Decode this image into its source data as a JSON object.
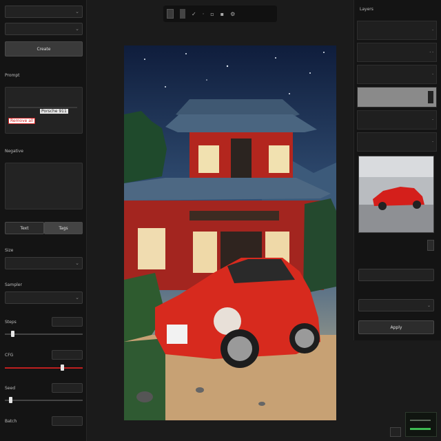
{
  "left": {
    "model_select": "",
    "preset_select": "",
    "generate_label": "Create",
    "prompt_label": "Prompt",
    "prompt_tag": "Porsche 911",
    "prompt_tag_alt": "Remove all",
    "neg_label": "Negative",
    "tab_a": "Text",
    "tab_b": "Tags",
    "size_label": "Size",
    "size_value": "",
    "sampler_label": "Sampler",
    "sampler_value": "",
    "steps_label": "Steps",
    "steps_value": "",
    "cfg_label": "CFG",
    "cfg_value": "",
    "seed_label": "Seed",
    "seed_value": "",
    "batch_label": "Batch",
    "batch_value": ""
  },
  "toolbar": {
    "icons": [
      "layers-icon",
      "undo-icon",
      "redo-icon",
      "crop-icon",
      "zoom-icon",
      "grid-icon",
      "settings-icon"
    ]
  },
  "right": {
    "header": "Layers",
    "rows": [
      "",
      "",
      "",
      "",
      "",
      ""
    ],
    "check_label": "",
    "field1_label": "",
    "field1_value": "",
    "field2_label": "",
    "field2_value": "",
    "apply_label": "Apply"
  },
  "slider_levels": {
    "steps": 0.08,
    "cfg": 0.75,
    "seed": 0.06
  },
  "colors": {
    "accent_red": "#d32020",
    "panel": "#141414",
    "bg": "#1b1b1b"
  }
}
